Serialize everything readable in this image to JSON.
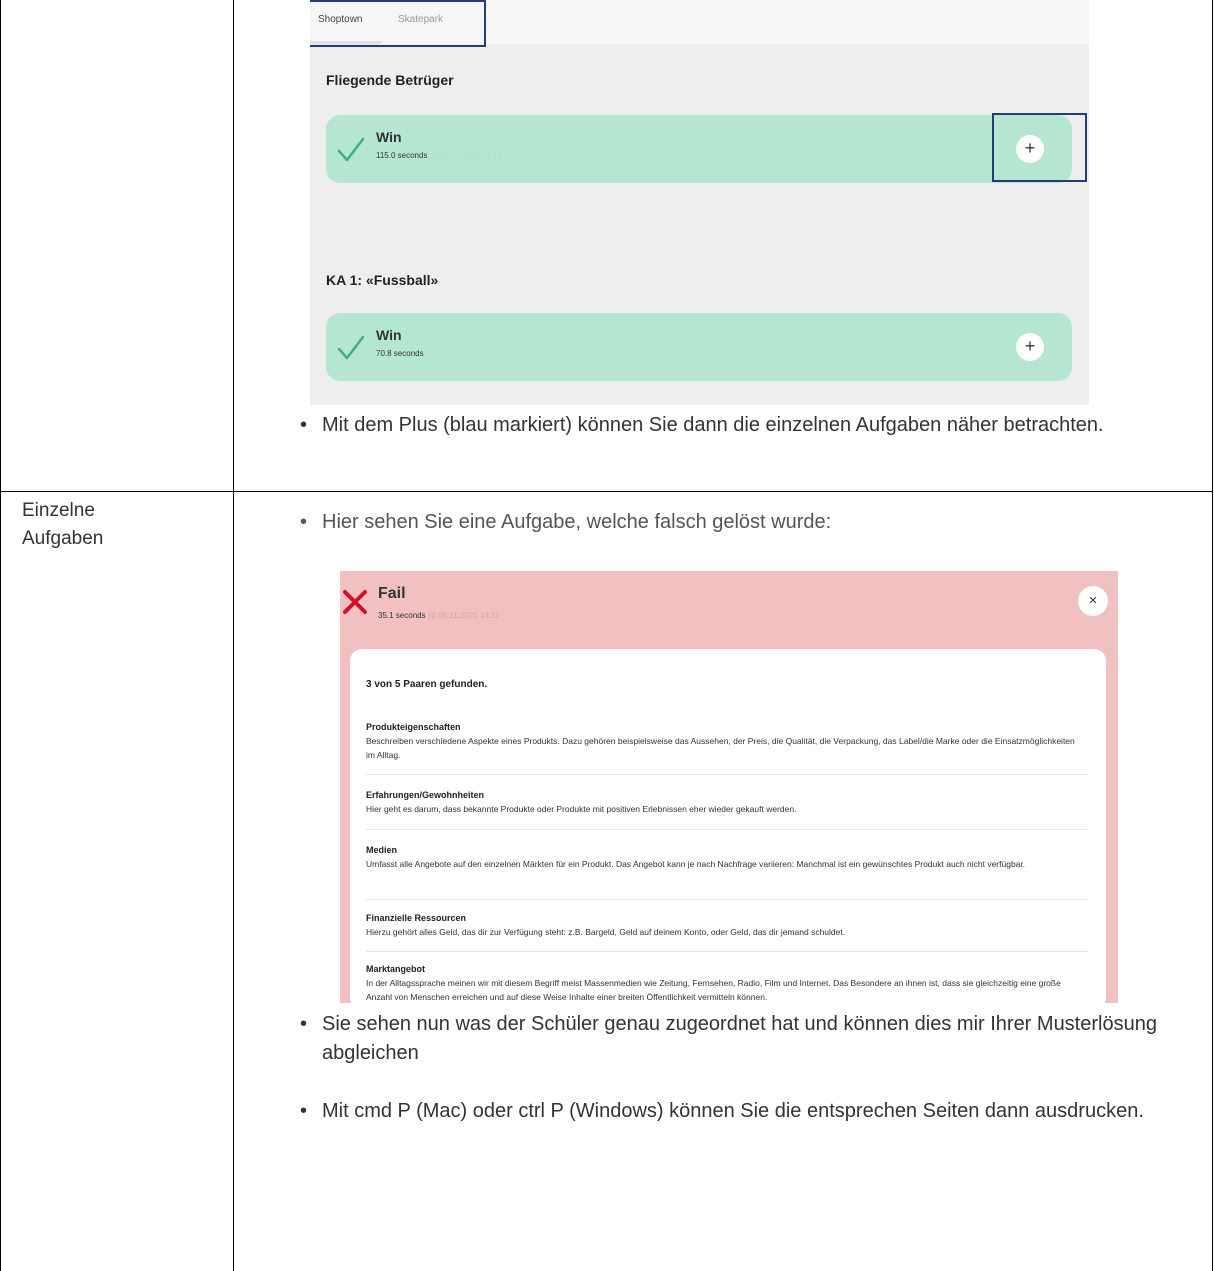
{
  "left_column": {
    "row2_label": "Einzelne Aufgaben"
  },
  "shot1": {
    "tabs": [
      "Shoptown",
      "Skatepark"
    ],
    "sections": [
      {
        "title": "Fliegende Betrüger",
        "result": "Win",
        "seconds": "115.0 seconds",
        "date": "@ 05.11.2021 14:14"
      },
      {
        "title": "KA 1: «Fussball»",
        "result": "Win",
        "seconds": "70.8 seconds",
        "date": "@ 05.11.2021 14:15"
      }
    ],
    "plus_symbol": "+"
  },
  "bullets": {
    "b1": "Mit dem Plus (blau markiert) können Sie dann die einzelnen Aufgaben näher betrachten.",
    "b2": "Hier sehen Sie eine Aufgabe, welche falsch gelöst wurde:",
    "b3": "Sie sehen nun was der Schüler genau zugeordnet hat und können dies mir Ihrer Musterlösung abgleichen",
    "b4": "Mit cmd P (Mac) oder ctrl P (Windows) können Sie die entsprechen Seiten dann ausdrucken."
  },
  "shot2": {
    "result": "Fail",
    "seconds": "35.1 seconds",
    "date": "@ 05.11.2021 14:11",
    "close_symbol": "×",
    "summary": "3 von 5 Paaren gefunden.",
    "entries": [
      {
        "head": "Produkteigenschaften",
        "body": "Beschreiben verschiedene Aspekte eines Produkts. Dazu gehören beispielsweise das Aussehen, der Preis, die Qualität, die Verpackung, das Label/die Marke oder die Einsatzmöglichkeiten im Alltag."
      },
      {
        "head": "Erfahrungen/Gewohnheiten",
        "body": "Hier geht es darum, dass bekannte Produkte oder Produkte mit positiven Erlebnissen eher wieder gekauft werden."
      },
      {
        "head": "Medien",
        "body": "Umfasst alle Angebote auf den einzelnen Märkten für ein Produkt. Das Angebot kann je nach Nachfrage variieren: Manchmal ist ein gewünschtes Produkt auch nicht verfügbar."
      },
      {
        "head": "Finanzielle Ressourcen",
        "body": "Hierzu gehört alles Geld, das dir zur Verfügung steht: z.B. Bargeld, Geld auf deinem Konto, oder Geld, das dir jemand schuldet."
      },
      {
        "head": "Marktangebot",
        "body": "In der Alltagssprache meinen wir mit diesem Begriff meist Massenmedien wie Zeitung, Fernsehen, Radio, Film und Internet. Das Besondere an ihnen ist, dass sie gleichzeitig eine große Anzahl von Menschen erreichen und auf diese Weise Inhalte einer breiten Öffentlichkeit vermitteln können."
      }
    ]
  }
}
